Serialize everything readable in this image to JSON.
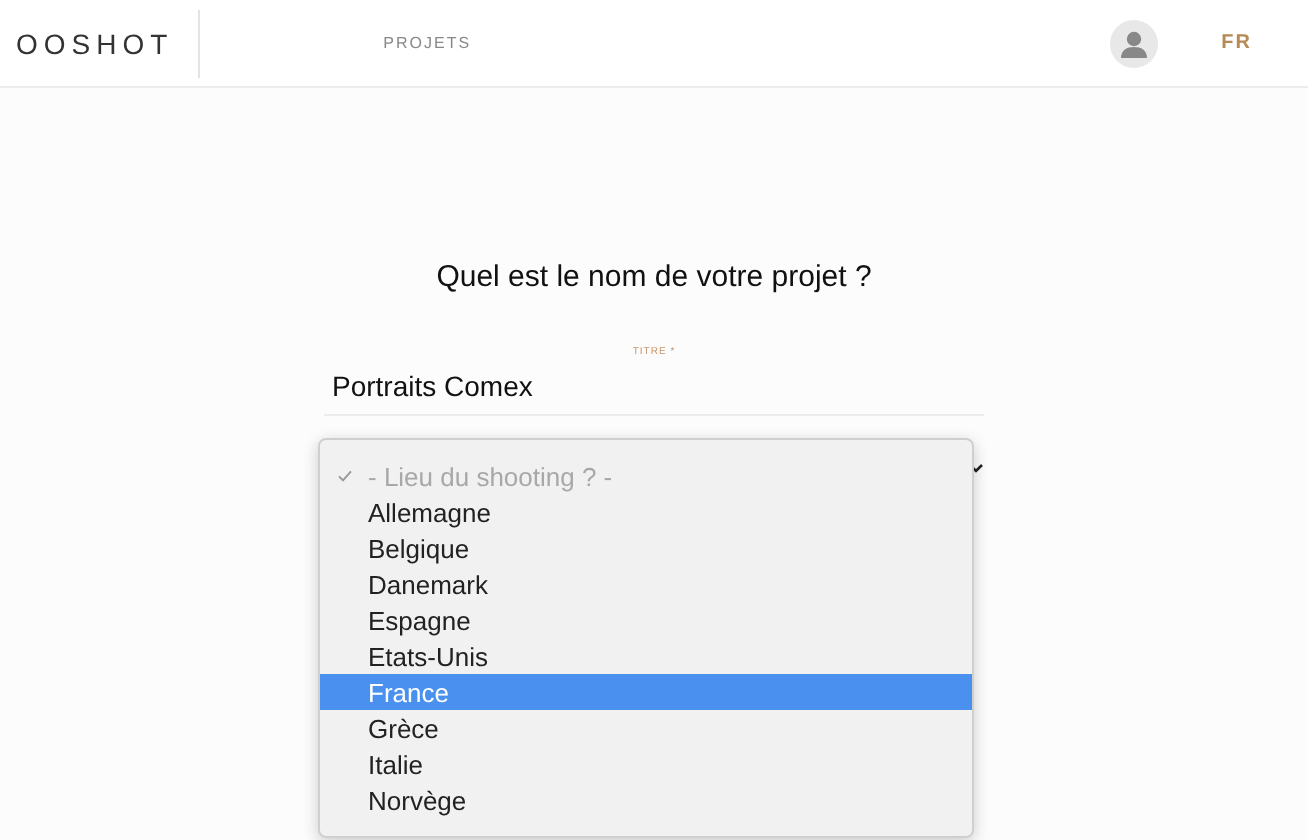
{
  "header": {
    "logo": "OOSHOT",
    "nav": [
      {
        "label": "PROJETS"
      }
    ],
    "language": "FR"
  },
  "heading": "Quel est le nom de votre projet ?",
  "title_field": {
    "label": "TITRE *",
    "value": "Portraits Comex"
  },
  "location_select": {
    "options": [
      {
        "label": "- Lieu du shooting ? -",
        "checked": true,
        "highlighted": false,
        "kind": "placeholder"
      },
      {
        "label": "Allemagne",
        "checked": false,
        "highlighted": false,
        "kind": "option"
      },
      {
        "label": "Belgique",
        "checked": false,
        "highlighted": false,
        "kind": "option"
      },
      {
        "label": "Danemark",
        "checked": false,
        "highlighted": false,
        "kind": "option"
      },
      {
        "label": "Espagne",
        "checked": false,
        "highlighted": false,
        "kind": "option"
      },
      {
        "label": "Etats-Unis",
        "checked": false,
        "highlighted": false,
        "kind": "option"
      },
      {
        "label": "France",
        "checked": false,
        "highlighted": true,
        "kind": "option"
      },
      {
        "label": "Grèce",
        "checked": false,
        "highlighted": false,
        "kind": "option"
      },
      {
        "label": "Italie",
        "checked": false,
        "highlighted": false,
        "kind": "option"
      },
      {
        "label": "Norvège",
        "checked": false,
        "highlighted": false,
        "kind": "option"
      }
    ]
  }
}
